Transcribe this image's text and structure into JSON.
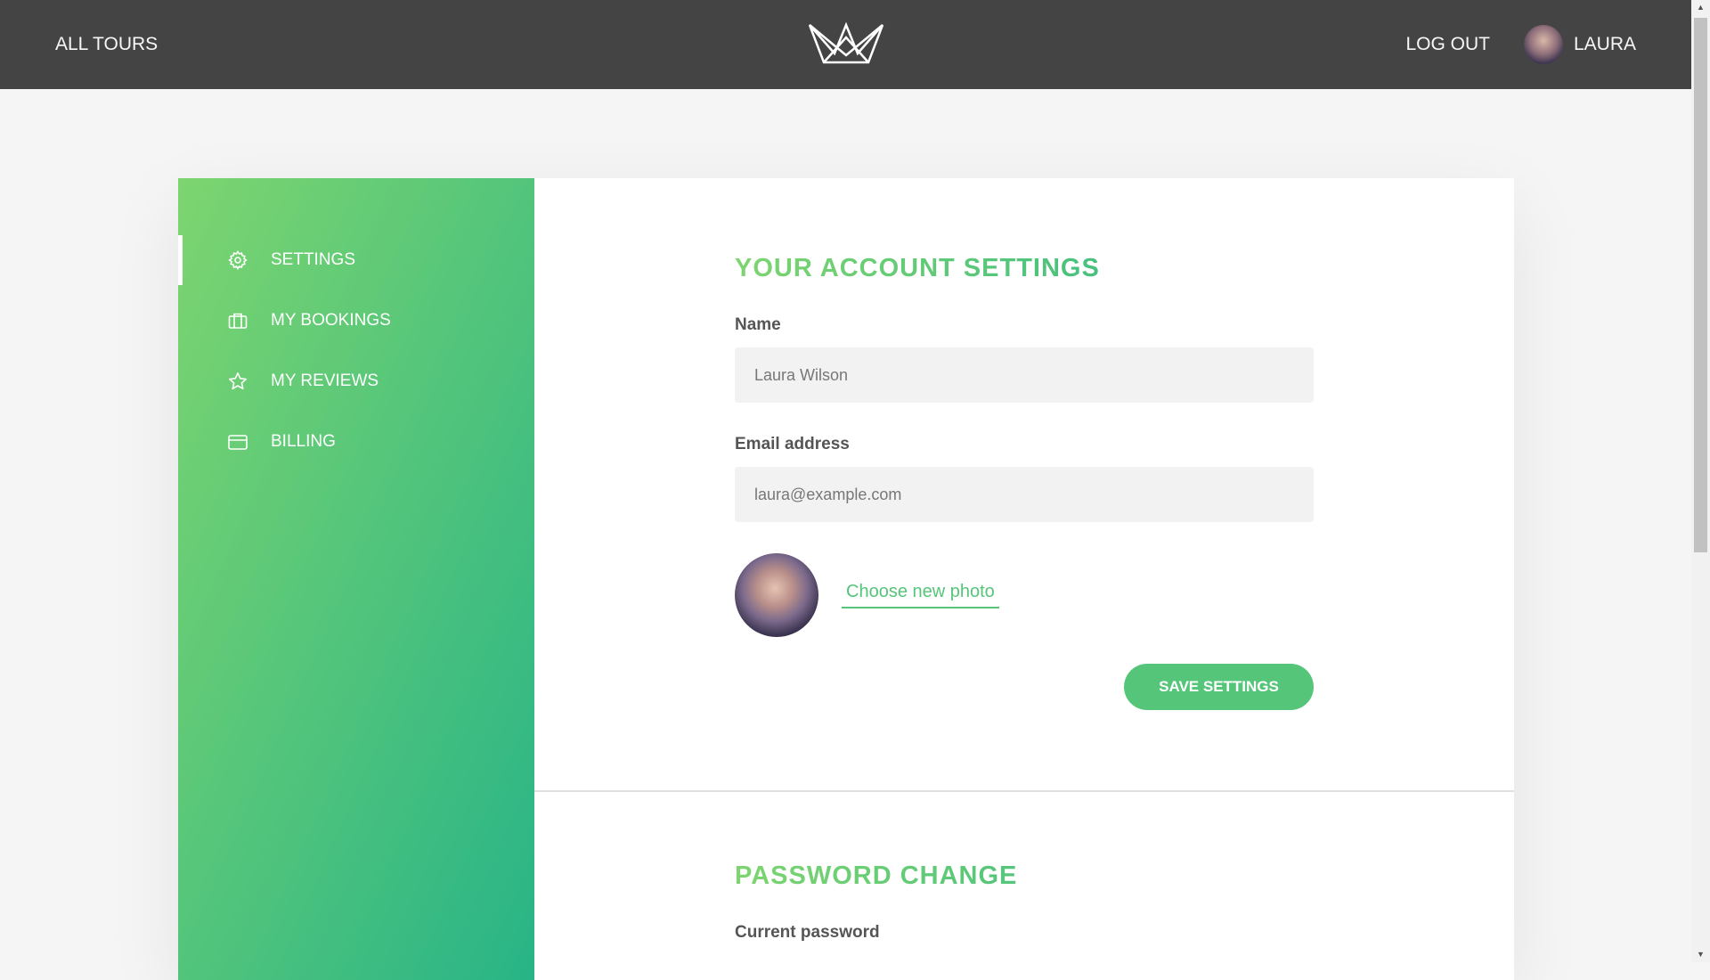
{
  "header": {
    "all_tours": "ALL TOURS",
    "log_out": "LOG OUT",
    "user_name": "LAURA"
  },
  "sidebar": {
    "items": [
      {
        "label": "SETTINGS",
        "icon": "gear-icon",
        "active": true
      },
      {
        "label": "MY BOOKINGS",
        "icon": "briefcase-icon"
      },
      {
        "label": "MY REVIEWS",
        "icon": "star-icon"
      },
      {
        "label": "BILLING",
        "icon": "credit-card-icon"
      }
    ]
  },
  "account": {
    "heading": "YOUR ACCOUNT SETTINGS",
    "name_label": "Name",
    "name_value": "Laura Wilson",
    "email_label": "Email address",
    "email_value": "laura@example.com",
    "photo_link": "Choose new photo",
    "save_button": "SAVE SETTINGS"
  },
  "password": {
    "heading": "PASSWORD CHANGE",
    "current_label": "Current password"
  },
  "colors": {
    "header_bg": "#444444",
    "accent": "#55c57a",
    "gradient_start": "#7dd56f",
    "gradient_end": "#28b487"
  }
}
